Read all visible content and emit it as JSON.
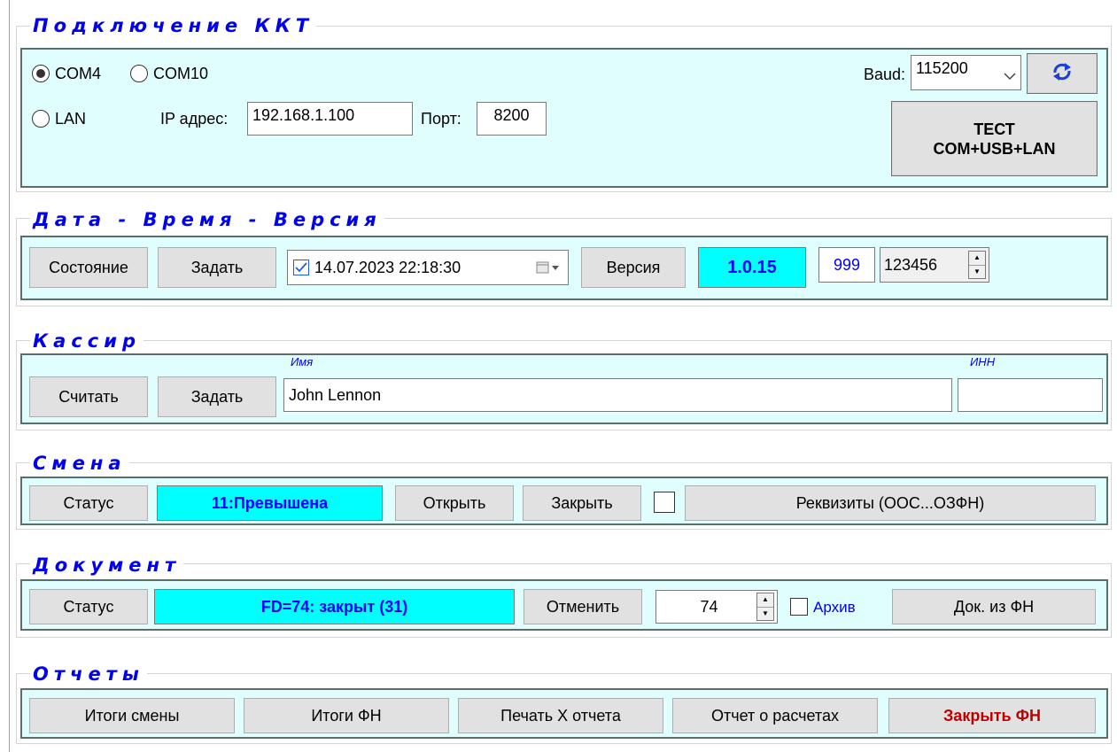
{
  "connection": {
    "title": "Подключение ККТ",
    "ports": [
      {
        "label": "COM4",
        "selected": true
      },
      {
        "label": "COM10",
        "selected": false
      }
    ],
    "lan": {
      "label": "LAN",
      "selected": false
    },
    "ip_label": "IP адрес:",
    "ip_value": "192.168.1.100",
    "port_label": "Порт:",
    "port_value": "8200",
    "baud_label": "Baud:",
    "baud_value": "115200",
    "refresh_icon": "refresh-icon",
    "test_button_line1": "ТЕСТ",
    "test_button_line2": "COM+USB+LAN"
  },
  "datetime": {
    "title": "Дата - Время - Версия",
    "state_button": "Состояние",
    "set_button": "Задать",
    "datetime_value": "14.07.2023 22:18:30",
    "datetime_checked": true,
    "version_button": "Версия",
    "version_value": "1.0.15",
    "field_999": "999",
    "spinner_value": "123456"
  },
  "cashier": {
    "title": "Кассир",
    "read_button": "Считать",
    "set_button": "Задать",
    "name_label": "Имя",
    "name_value": "John Lennon",
    "inn_label": "ИНН",
    "inn_value": ""
  },
  "shift": {
    "title": "Смена",
    "status_button": "Статус",
    "status_value": "11:Превышена",
    "open_button": "Открыть",
    "close_button": "Закрыть",
    "checkbox_checked": false,
    "requisites_button": "Реквизиты (ООС...ОЗФН)"
  },
  "document": {
    "title": "Документ",
    "status_button": "Статус",
    "status_value": "FD=74: закрыт (31)",
    "cancel_button": "Отменить",
    "number_value": "74",
    "archive_label": "Архив",
    "archive_checked": false,
    "doc_from_fn_button": "Док. из ФН"
  },
  "reports": {
    "title": "Отчеты",
    "buttons": [
      "Итоги смены",
      "Итоги ФН",
      "Печать X отчета",
      "Отчет о расчетах",
      "Закрыть ФН"
    ],
    "danger_color": "#c00000"
  }
}
